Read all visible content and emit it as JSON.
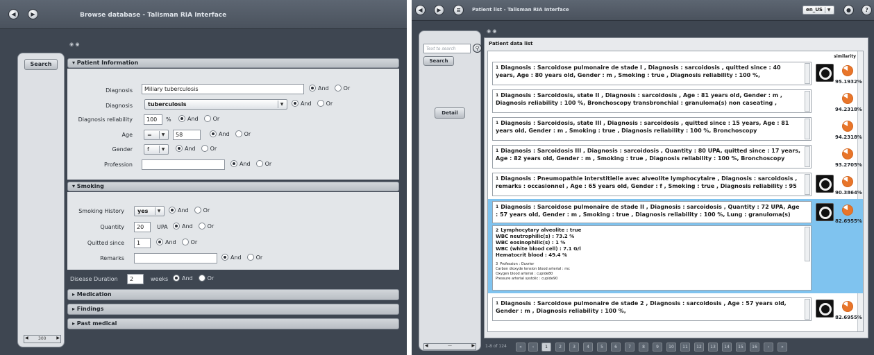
{
  "left_window": {
    "title": "Browse database - Talisman RIA Interface",
    "search_button": "Search",
    "sidebar_pager": "300",
    "sections": {
      "patient_information": {
        "label": "▾ Patient Information",
        "diagnosis_text": {
          "label": "Diagnosis",
          "value": "Miliary tuberculosis"
        },
        "diagnosis_select": {
          "label": "Diagnosis",
          "value": "tuberculosis"
        },
        "diagnosis_reliability": {
          "label": "Diagnosis reliability",
          "value": "100",
          "unit": "%"
        },
        "age": {
          "label": "Age",
          "operator": "=",
          "value": "58"
        },
        "gender": {
          "label": "Gender",
          "value": "f"
        },
        "profession": {
          "label": "Profession",
          "value": ""
        }
      },
      "smoking": {
        "label": "▾ Smoking",
        "smoking_history": {
          "label": "Smoking History",
          "value": "yes"
        },
        "quantity": {
          "label": "Quantity",
          "value": "20",
          "unit": "UPA"
        },
        "quitted_since": {
          "label": "Quitted since",
          "value": "1"
        },
        "remarks": {
          "label": "Remarks",
          "value": ""
        }
      },
      "disease_duration": {
        "label": "Disease Duration",
        "value": "2",
        "unit": "weeks"
      },
      "medication": "▸ Medication",
      "findings": "▸ Findings",
      "past_medical": "▸ Past medical"
    },
    "radio_and": "And",
    "radio_or": "Or"
  },
  "right_window": {
    "title": "Patient list - Talisman RIA Interface",
    "locale": "en_US",
    "search_placeholder": "Text to search",
    "search_button": "Search",
    "detail_button": "Detail",
    "list_title": "Patient data list",
    "similarity_header": "similarity",
    "results": [
      {
        "num": "1",
        "text": "Diagnosis : Sarcoidose pulmonaire de stade I , Diagnosis : sarcoidosis , quitted since : 40 years, Age : 80 years old, Gender : m , Smoking : true , Diagnosis reliability : 100 %,",
        "similarity": "95.1932%"
      },
      {
        "num": "1",
        "text": "Diagnosis : Sarcoidosis, state II , Diagnosis : sarcoidosis , Age : 81 years old, Gender : m , Diagnosis reliability : 100 %, Bronchoscopy transbronchial : granuloma(s) non caseating ,",
        "similarity": "94.2318%"
      },
      {
        "num": "1",
        "text": "Diagnosis : Sarcoidosis, state III , Diagnosis : sarcoidosis , quitted since : 15 years, Age : 81 years old, Gender : m , Smoking : true , Diagnosis reliability : 100 %, Bronchoscopy",
        "similarity": "94.2318%"
      },
      {
        "num": "1",
        "text": "Diagnosis : Sarcoidosis III , Diagnosis : sarcoidosis , Quantity : 80 UPA, quitted since : 17 years, Age : 82 years old, Gender : m , Smoking : true , Diagnosis reliability : 100 %, Bronchoscopy",
        "similarity": "93.2705%"
      },
      {
        "num": "1",
        "text": "Diagnosis : Pneumopathie interstitielle avec alveolite lymphocytaire , Diagnosis : sarcoidosis , remarks : occasionnel , Age : 65 years old, Gender : f , Smoking : true , Diagnosis reliability : 95",
        "similarity": "90.3864%"
      },
      {
        "num": "1",
        "text": "Diagnosis : Sarcoidose pulmonaire de stade II , Diagnosis : sarcoidosis , Quantity : 72 UPA, Age : 57 years old, Gender : m , Smoking : true , Diagnosis reliability : 100 %, Lung : granuloma(s)",
        "similarity": "82.6955%"
      },
      {
        "num": "1",
        "text": "Diagnosis : Sarcoidose pulmonaire de stade 2 , Diagnosis : sarcoidosis , Age : 57 years old, Gender : m , Diagnosis reliability : 100 %,",
        "similarity": "82.6955%"
      }
    ],
    "expanded_detail": {
      "num": "2",
      "lines": [
        "Lymphocytary alveolite : true",
        "WBC neutrophilic(s) : 73.2 %",
        "WBC eosinophilic(s) : 1 %",
        "WBC (white blood cell) : 7.1 G/l",
        "Hematocrit blood : 49.4 %"
      ],
      "small_num": "3",
      "small_lines": [
        "Profession : Ouvrier",
        "Carbon dioxyde tension blood arterial : mc",
        "Oxygen blood arterial : cupide80",
        "Pressure arterial systolic : cupide90"
      ]
    },
    "pagination": {
      "info": "1-8 of 124",
      "pages": [
        "1",
        "2",
        "3",
        "4",
        "5",
        "6",
        "7",
        "8",
        "9",
        "10",
        "11",
        "12",
        "13",
        "14",
        "15",
        "16"
      ]
    },
    "sidebar_pager": "—"
  },
  "colors": {
    "selected_row": "#7fc3ef",
    "similarity_pie": "#e8752a",
    "window_bg": "#3e4651"
  }
}
